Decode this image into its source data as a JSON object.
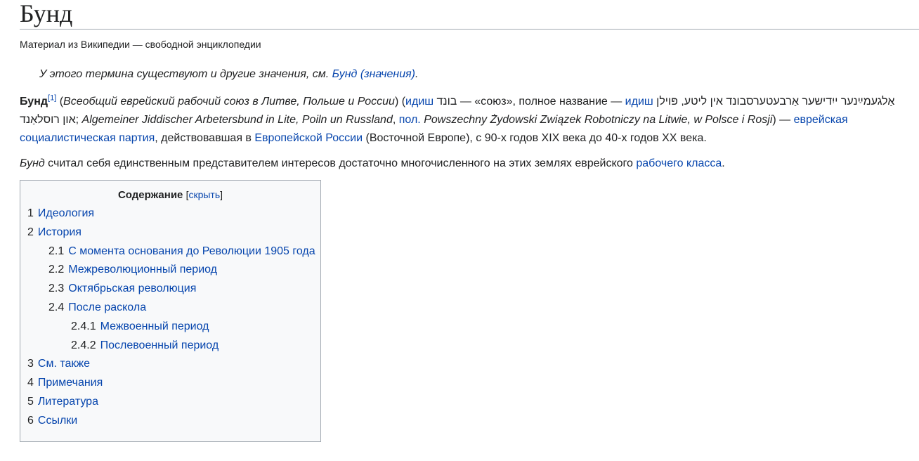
{
  "page": {
    "title": "Бунд",
    "subtitle": "Материал из Википедии — свободной энциклопедии"
  },
  "hatnote": {
    "prefix": "У этого термина существуют и другие значения, см. ",
    "link": "Бунд (значения)",
    "suffix": "."
  },
  "lead": {
    "p1": {
      "bold": "Бунд",
      "ref": "[1]",
      "t1": " (",
      "i1": "Всеобщий еврейский рабочий союз в Литве, Польше и России",
      "t2": ") (",
      "l1": "идиш",
      "t3": " ",
      "heb1": "בונד",
      "t4": " — «союз», полное название — ",
      "l2": "идиш",
      "t5": " ",
      "heb2": "אַלגעמײַנער ייִדישער אַרבעטערסבונד אין ליטע, פּוילן און רוסלאַנד",
      "t6": "; ",
      "i2": "Algemeiner Jiddischer Arbetersbund in Lite, Poiln un Russland",
      "t7": ", ",
      "l3": "пол.",
      "t8": " ",
      "i3": "Powszechny Żydowski Związek Robotniczy na Litwie, w Polsce i Rosji",
      "t9": ") — ",
      "l4": "еврейская социалистическая партия",
      "t10": ", действовавшая в ",
      "l5": "Европейской России",
      "t11": " (Восточной Европе), с 90-х годов XIX века до 40-х годов XX века."
    },
    "p2": {
      "i1": "Бунд",
      "t1": " считал себя единственным представителем интересов достаточно многочисленного на этих землях еврейского ",
      "l1": "рабочего класса",
      "t2": "."
    }
  },
  "toc": {
    "title": "Содержание",
    "bracket_open": "[",
    "toggle": "скрыть",
    "bracket_close": "]",
    "items": [
      {
        "num": "1",
        "label": "Идеология",
        "level": 1
      },
      {
        "num": "2",
        "label": "История",
        "level": 1
      },
      {
        "num": "2.1",
        "label": "С момента основания до Революции 1905 года",
        "level": 2
      },
      {
        "num": "2.2",
        "label": "Межреволюционный период",
        "level": 2
      },
      {
        "num": "2.3",
        "label": "Октябрьская революция",
        "level": 2
      },
      {
        "num": "2.4",
        "label": "После раскола",
        "level": 2
      },
      {
        "num": "2.4.1",
        "label": "Межвоенный период",
        "level": 3
      },
      {
        "num": "2.4.2",
        "label": "Послевоенный период",
        "level": 3
      },
      {
        "num": "3",
        "label": "См. также",
        "level": 1
      },
      {
        "num": "4",
        "label": "Примечания",
        "level": 1
      },
      {
        "num": "5",
        "label": "Литература",
        "level": 1
      },
      {
        "num": "6",
        "label": "Ссылки",
        "level": 1
      }
    ]
  },
  "colors": {
    "link": "#0645ad",
    "text": "#202122",
    "toc_bg": "#f8f9fa",
    "border": "#a2a9b1"
  }
}
